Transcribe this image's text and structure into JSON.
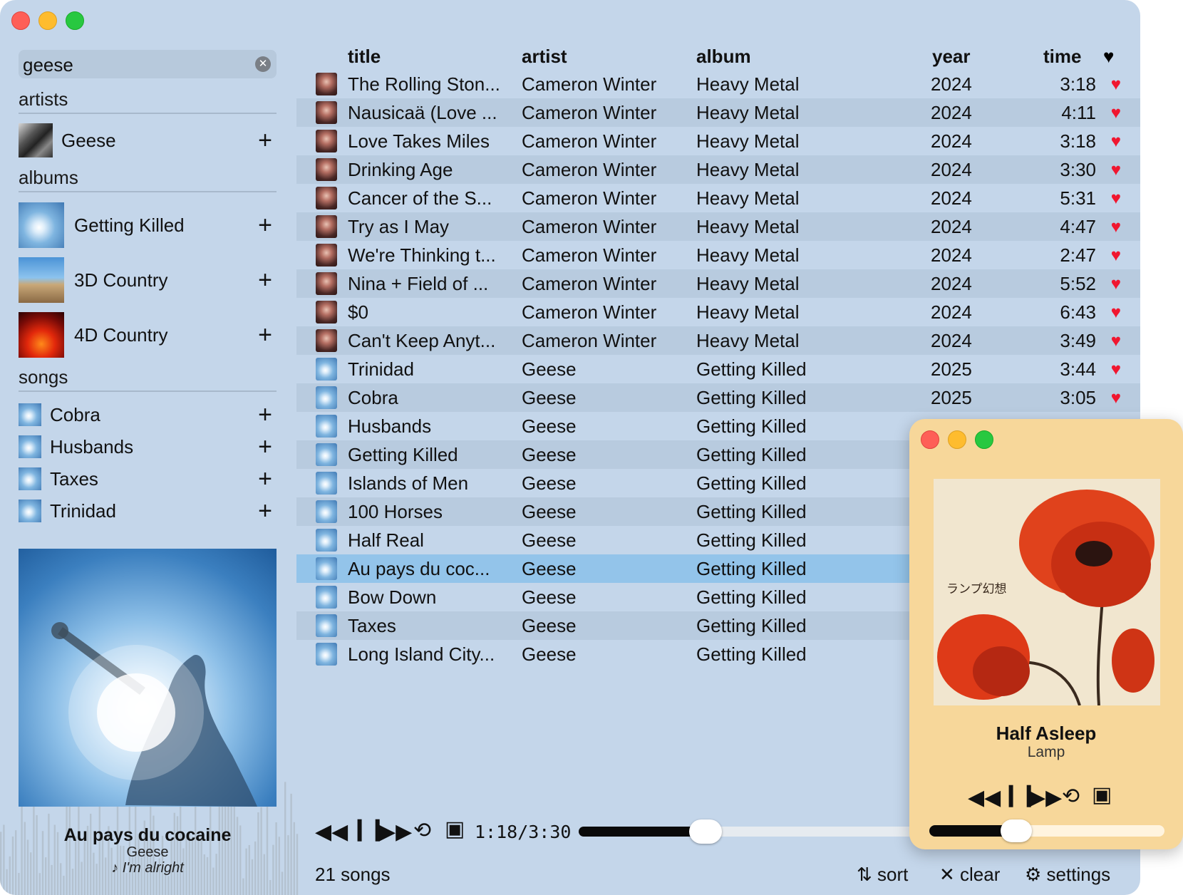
{
  "search": {
    "value": "geese"
  },
  "sidebar": {
    "artists_header": "artists",
    "artists": [
      {
        "name": "Geese"
      }
    ],
    "albums_header": "albums",
    "albums": [
      {
        "name": "Getting Killed"
      },
      {
        "name": "3D Country"
      },
      {
        "name": "4D Country"
      }
    ],
    "songs_header": "songs",
    "songs": [
      {
        "name": "Cobra"
      },
      {
        "name": "Husbands"
      },
      {
        "name": "Taxes"
      },
      {
        "name": "Trinidad"
      }
    ],
    "add_symbol": "+"
  },
  "now_playing": {
    "title": "Au pays du cocaine",
    "artist": "Geese",
    "lyric": "♪ I'm alright"
  },
  "table": {
    "columns": {
      "title": "title",
      "artist": "artist",
      "album": "album",
      "year": "year",
      "time": "time",
      "liked": "♥"
    },
    "rows": [
      {
        "title": "The Rolling Ston...",
        "artist": "Cameron Winter",
        "album": "Heavy Metal",
        "year": "2024",
        "time": "3:18",
        "liked": true
      },
      {
        "title": "Nausicaä (Love ...",
        "artist": "Cameron Winter",
        "album": "Heavy Metal",
        "year": "2024",
        "time": "4:11",
        "liked": true
      },
      {
        "title": "Love Takes Miles",
        "artist": "Cameron Winter",
        "album": "Heavy Metal",
        "year": "2024",
        "time": "3:18",
        "liked": true
      },
      {
        "title": "Drinking Age",
        "artist": "Cameron Winter",
        "album": "Heavy Metal",
        "year": "2024",
        "time": "3:30",
        "liked": true
      },
      {
        "title": "Cancer of the S...",
        "artist": "Cameron Winter",
        "album": "Heavy Metal",
        "year": "2024",
        "time": "5:31",
        "liked": true
      },
      {
        "title": "Try as I May",
        "artist": "Cameron Winter",
        "album": "Heavy Metal",
        "year": "2024",
        "time": "4:47",
        "liked": true
      },
      {
        "title": "We're Thinking t...",
        "artist": "Cameron Winter",
        "album": "Heavy Metal",
        "year": "2024",
        "time": "2:47",
        "liked": true
      },
      {
        "title": "Nina + Field of ...",
        "artist": "Cameron Winter",
        "album": "Heavy Metal",
        "year": "2024",
        "time": "5:52",
        "liked": true
      },
      {
        "title": "$0",
        "artist": "Cameron Winter",
        "album": "Heavy Metal",
        "year": "2024",
        "time": "6:43",
        "liked": true
      },
      {
        "title": "Can't Keep Anyt...",
        "artist": "Cameron Winter",
        "album": "Heavy Metal",
        "year": "2024",
        "time": "3:49",
        "liked": true
      },
      {
        "title": "Trinidad",
        "artist": "Geese",
        "album": "Getting Killed",
        "year": "2025",
        "time": "3:44",
        "liked": true
      },
      {
        "title": "Cobra",
        "artist": "Geese",
        "album": "Getting Killed",
        "year": "2025",
        "time": "3:05",
        "liked": true
      },
      {
        "title": "Husbands",
        "artist": "Geese",
        "album": "Getting Killed",
        "year": "",
        "time": "",
        "liked": false
      },
      {
        "title": "Getting Killed",
        "artist": "Geese",
        "album": "Getting Killed",
        "year": "",
        "time": "",
        "liked": false
      },
      {
        "title": "Islands of Men",
        "artist": "Geese",
        "album": "Getting Killed",
        "year": "",
        "time": "",
        "liked": false
      },
      {
        "title": "100 Horses",
        "artist": "Geese",
        "album": "Getting Killed",
        "year": "",
        "time": "",
        "liked": false
      },
      {
        "title": "Half Real",
        "artist": "Geese",
        "album": "Getting Killed",
        "year": "",
        "time": "",
        "liked": false
      },
      {
        "title": "Au pays du coc...",
        "artist": "Geese",
        "album": "Getting Killed",
        "year": "",
        "time": "",
        "liked": false,
        "selected": true
      },
      {
        "title": "Bow Down",
        "artist": "Geese",
        "album": "Getting Killed",
        "year": "",
        "time": "",
        "liked": false
      },
      {
        "title": "Taxes",
        "artist": "Geese",
        "album": "Getting Killed",
        "year": "",
        "time": "",
        "liked": false
      },
      {
        "title": "Long Island City...",
        "artist": "Geese",
        "album": "Getting Killed",
        "year": "",
        "time": "",
        "liked": false
      }
    ]
  },
  "transport": {
    "time": "1:18/3:30",
    "progress": 0.37,
    "icons": {
      "rewind": "rewind-icon",
      "pause": "pause-icon",
      "forward": "fast-forward-icon",
      "repeat": "repeat-icon",
      "artwork": "artwork-icon"
    }
  },
  "footer": {
    "count": "21 songs",
    "sort": "sort",
    "clear": "clear",
    "settings": "settings"
  },
  "mini_player": {
    "title": "Half Asleep",
    "artist": "Lamp",
    "art_text": "ランプ幻想",
    "progress": 0.37
  },
  "colors": {
    "main_bg": "#c4d6ea",
    "row_alt": "#b8cbdf",
    "row_selected": "#93c4ea",
    "heart": "#f0162f",
    "mini_bg": "#f7d79a"
  }
}
